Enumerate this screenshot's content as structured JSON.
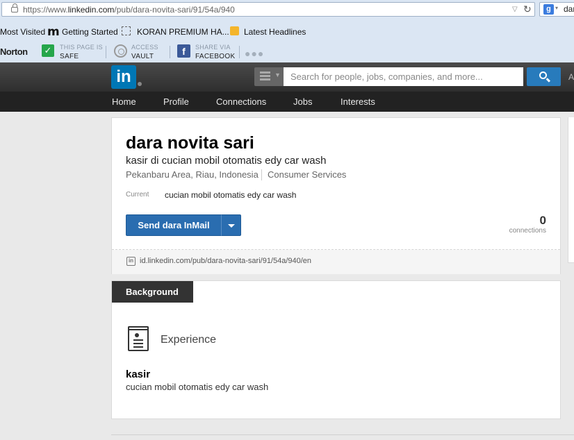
{
  "browser": {
    "url_prefix": "https://www.",
    "url_domain": "linkedin.com",
    "url_path": "/pub/dara-novita-sari/91/54a/940",
    "search_engine_text": "dar",
    "bookmarks": [
      "Most Visited",
      "Getting Started",
      "KORAN PREMIUM HA...",
      "Latest Headlines"
    ]
  },
  "norton": {
    "logo": "Norton",
    "safe_small": "THIS PAGE IS",
    "safe_big": "SAFE",
    "vault_small": "ACCESS",
    "vault_big": "VAULT",
    "fb_small": "SHARE VIA",
    "fb_big": "FACEBOOK"
  },
  "header": {
    "logo_text": "in",
    "search_placeholder": "Search for people, jobs, companies, and more...",
    "cut_text": "A"
  },
  "nav": [
    "Home",
    "Profile",
    "Connections",
    "Jobs",
    "Interests"
  ],
  "profile": {
    "name": "dara novita sari",
    "headline": "kasir di cucian mobil otomatis edy car wash",
    "location": "Pekanbaru Area, Riau, Indonesia",
    "industry": "Consumer Services",
    "current_label": "Current",
    "current_value": "cucian mobil otomatis edy car wash",
    "inmail_label": "Send dara InMail",
    "connections_count": "0",
    "connections_label": "connections",
    "public_url": "id.linkedin.com/pub/dara-novita-sari/91/54a/940/en"
  },
  "background": {
    "tab_label": "Background",
    "section_title": "Experience",
    "job_title": "kasir",
    "job_company": "cucian mobil otomatis edy car wash"
  },
  "colors": {
    "linkedin_blue": "#0077b5",
    "button_blue": "#2a6db0",
    "header_dark": "#333333"
  }
}
